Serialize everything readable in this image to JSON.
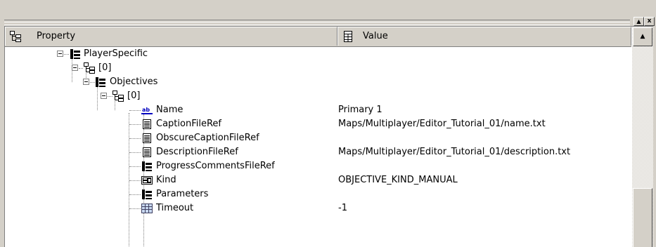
{
  "header": {
    "property_label": "Property",
    "value_label": "Value"
  },
  "window_buttons": {
    "up_glyph": "▲",
    "close_glyph": "x"
  },
  "scrollbar": {
    "up_glyph": "▲"
  },
  "tree": {
    "rows": [
      {
        "name": "PlayerSpecific",
        "value": "",
        "icon": "folder-list-icon"
      },
      {
        "name": "[0]",
        "value": "",
        "icon": "array-item-icon"
      },
      {
        "name": "Objectives",
        "value": "",
        "icon": "folder-list-icon"
      },
      {
        "name": "[0]",
        "value": "",
        "icon": "array-item-icon"
      },
      {
        "name": "Name",
        "value": "Primary 1",
        "icon": "string-ab-icon"
      },
      {
        "name": "CaptionFileRef",
        "value": "Maps/Multiplayer/Editor_Tutorial_01/name.txt",
        "icon": "file-ref-icon"
      },
      {
        "name": "ObscureCaptionFileRef",
        "value": "",
        "icon": "file-ref-icon"
      },
      {
        "name": "DescriptionFileRef",
        "value": "Maps/Multiplayer/Editor_Tutorial_01/description.txt",
        "icon": "file-ref-icon"
      },
      {
        "name": "ProgressCommentsFileRef",
        "value": "",
        "icon": "folder-list-icon"
      },
      {
        "name": "Kind",
        "value": "OBJECTIVE_KIND_MANUAL",
        "icon": "enum-icon"
      },
      {
        "name": "Parameters",
        "value": "",
        "icon": "folder-list-icon"
      },
      {
        "name": "Timeout",
        "value": "-1",
        "icon": "number-icon"
      }
    ]
  }
}
